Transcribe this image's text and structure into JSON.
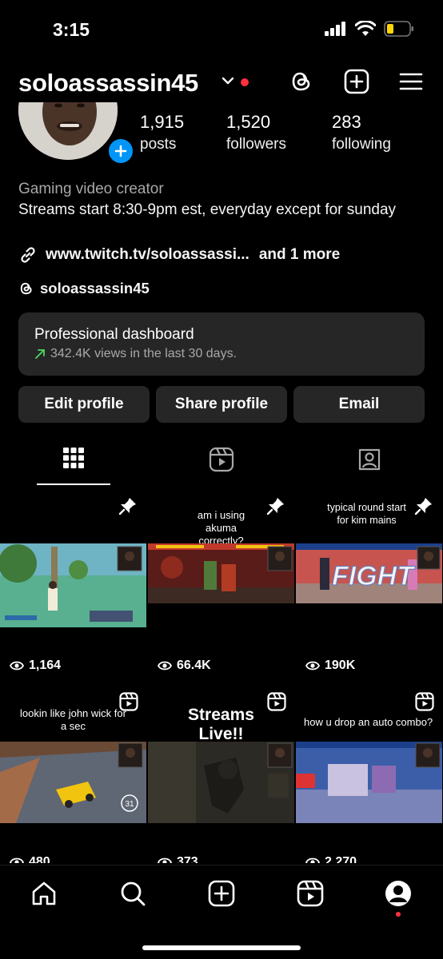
{
  "status": {
    "time": "3:15"
  },
  "header": {
    "username": "soloassassin45"
  },
  "stats": [
    {
      "value": "1,915",
      "label": "posts"
    },
    {
      "value": "1,520",
      "label": "followers"
    },
    {
      "value": "283",
      "label": "following"
    }
  ],
  "bio": {
    "category": "Gaming video creator",
    "text": "Streams start 8:30-9pm est, everyday except for sunday",
    "link": "www.twitch.tv/soloassassi...",
    "link_more": "and 1 more",
    "threads_handle": "soloassassin45"
  },
  "dashboard": {
    "title": "Professional dashboard",
    "subtitle": "342.4K views in the last 30 days.",
    "trend_color": "#4cd964"
  },
  "buttons": {
    "edit": "Edit profile",
    "share": "Share profile",
    "email": "Email"
  },
  "tabs": [
    {
      "name": "grid",
      "icon": "grid-icon",
      "active": true
    },
    {
      "name": "reels",
      "icon": "reels-icon",
      "active": false
    },
    {
      "name": "tagged",
      "icon": "tagged-icon",
      "active": false
    }
  ],
  "posts": [
    {
      "caption": "",
      "views": "1,164",
      "badge": "pin-icon"
    },
    {
      "caption": "am i using akuma correctly?",
      "views": "66.4K",
      "badge": "pin-icon"
    },
    {
      "caption": "typical round start for kim mains",
      "views": "190K",
      "badge": "pin-icon"
    },
    {
      "caption": "lookin like john wick for a sec",
      "views": "480",
      "badge": "reel-icon"
    },
    {
      "caption": "Streams Live!!",
      "views": "373",
      "badge": "reel-icon"
    },
    {
      "caption": "how u drop an auto combo?",
      "views": "2,270",
      "badge": "reel-icon"
    }
  ],
  "overlay": {
    "fight_text": "FIGHT",
    "zoom_digits": "31"
  },
  "nav": [
    "home-icon",
    "search-icon",
    "create-icon",
    "reels-icon",
    "profile-icon"
  ],
  "colors": {
    "accent_blue": "#0095f6",
    "notify_red": "#ff3040",
    "card_bg": "#262626"
  }
}
